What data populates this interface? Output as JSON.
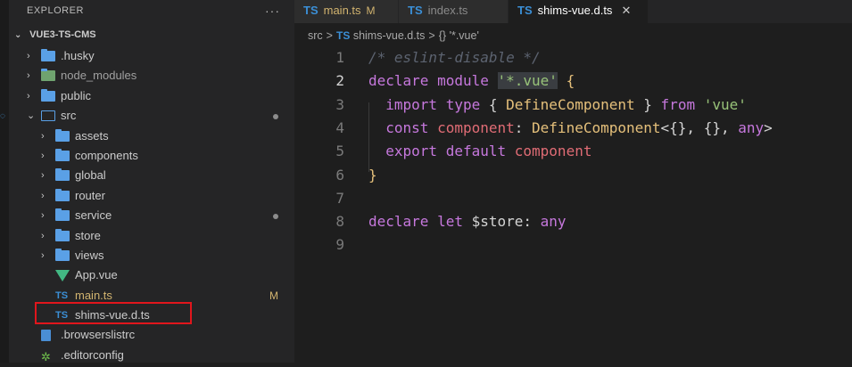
{
  "sidebar": {
    "title": "EXPLORER",
    "more_icon": "···",
    "project": "VUE3-TS-CMS",
    "items": [
      {
        "label": ".husky",
        "kind": "folder",
        "depth": 0,
        "chevron": "›"
      },
      {
        "label": "node_modules",
        "kind": "folder-node",
        "depth": 0,
        "chevron": "›"
      },
      {
        "label": "public",
        "kind": "folder",
        "depth": 0,
        "chevron": "›"
      },
      {
        "label": "src",
        "kind": "folder-open",
        "depth": 0,
        "chevron": "⌄",
        "dot": true
      },
      {
        "label": "assets",
        "kind": "folder",
        "depth": 1,
        "chevron": "›"
      },
      {
        "label": "components",
        "kind": "folder",
        "depth": 1,
        "chevron": "›"
      },
      {
        "label": "global",
        "kind": "folder",
        "depth": 1,
        "chevron": "›"
      },
      {
        "label": "router",
        "kind": "folder",
        "depth": 1,
        "chevron": "›"
      },
      {
        "label": "service",
        "kind": "folder",
        "depth": 1,
        "chevron": "›",
        "dot": true
      },
      {
        "label": "store",
        "kind": "folder",
        "depth": 1,
        "chevron": "›"
      },
      {
        "label": "views",
        "kind": "folder",
        "depth": 1,
        "chevron": "›"
      },
      {
        "label": "App.vue",
        "kind": "vue",
        "depth": 1
      },
      {
        "label": "main.ts",
        "kind": "ts",
        "depth": 1,
        "badge": "M"
      },
      {
        "label": "shims-vue.d.ts",
        "kind": "ts",
        "depth": 1
      },
      {
        "label": ".browserslistrc",
        "kind": "file",
        "depth": 0
      },
      {
        "label": ".editorconfig",
        "kind": "gear",
        "depth": 0
      }
    ],
    "colors": {
      "folder": "#5aa0e6",
      "modified": "#d2b46f",
      "selection_box": "#e1161c"
    }
  },
  "tabs": [
    {
      "icon": "TS",
      "label": "main.ts",
      "badge": "M",
      "active": false
    },
    {
      "icon": "TS",
      "label": "index.ts",
      "active": false
    },
    {
      "icon": "TS",
      "label": "shims-vue.d.ts",
      "close": "✕",
      "active": true
    }
  ],
  "breadcrumb": {
    "folder": "src",
    "sep": ">",
    "file_icon": "TS",
    "file": "shims-vue.d.ts",
    "symbol_icon": "{}",
    "symbol": "'*.vue'"
  },
  "editor": {
    "current_line": 2,
    "lines": [
      {
        "n": "1",
        "tokens": [
          [
            "cm",
            "/* eslint-disable */"
          ]
        ]
      },
      {
        "n": "2",
        "tokens": [
          [
            "kw",
            "declare "
          ],
          [
            "kw",
            "module "
          ],
          [
            "hl-str",
            "'*.vue'"
          ],
          [
            "pl",
            " "
          ],
          [
            "br",
            "{"
          ]
        ]
      },
      {
        "n": "3",
        "tokens": [
          [
            "pl",
            "  "
          ],
          [
            "kw",
            "import "
          ],
          [
            "kw",
            "type "
          ],
          [
            "pl",
            "{ "
          ],
          [
            "ty",
            "DefineComponent"
          ],
          [
            "pl",
            " } "
          ],
          [
            "kw",
            "from "
          ],
          [
            "str",
            "'vue'"
          ]
        ]
      },
      {
        "n": "4",
        "tokens": [
          [
            "pl",
            "  "
          ],
          [
            "kw",
            "const "
          ],
          [
            "vr",
            "component"
          ],
          [
            "pl",
            ": "
          ],
          [
            "ty",
            "DefineComponent"
          ],
          [
            "pl",
            "<{}, {}, "
          ],
          [
            "kw",
            "any"
          ],
          [
            "pl",
            ">"
          ]
        ]
      },
      {
        "n": "5",
        "tokens": [
          [
            "pl",
            "  "
          ],
          [
            "kw",
            "export "
          ],
          [
            "kw",
            "default "
          ],
          [
            "vr",
            "component"
          ]
        ]
      },
      {
        "n": "6",
        "tokens": [
          [
            "br",
            "}"
          ]
        ]
      },
      {
        "n": "7",
        "tokens": []
      },
      {
        "n": "8",
        "tokens": [
          [
            "kw",
            "declare "
          ],
          [
            "kw",
            "let "
          ],
          [
            "pl",
            "$store"
          ],
          [
            "pl",
            ": "
          ],
          [
            "kw",
            "any"
          ]
        ]
      },
      {
        "n": "9",
        "tokens": []
      }
    ]
  }
}
